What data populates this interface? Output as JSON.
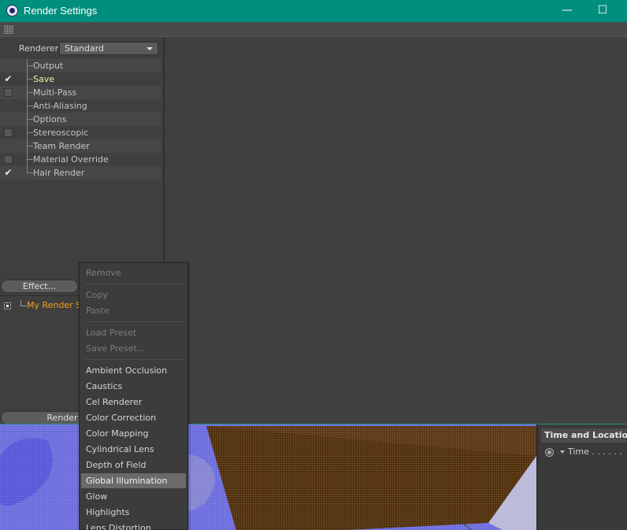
{
  "window": {
    "title": "Render Settings",
    "minimize_glyph": "—",
    "maximize_glyph": "☐"
  },
  "renderer": {
    "label": "Renderer",
    "selected": "Standard"
  },
  "settings_tree": [
    {
      "label": "Output",
      "check": "none",
      "active": false
    },
    {
      "label": "Save",
      "check": "checked",
      "active": true
    },
    {
      "label": "Multi-Pass",
      "check": "unchecked",
      "active": false
    },
    {
      "label": "Anti-Aliasing",
      "check": "none",
      "active": false
    },
    {
      "label": "Options",
      "check": "none",
      "active": false
    },
    {
      "label": "Stereoscopic",
      "check": "unchecked",
      "active": false
    },
    {
      "label": "Team Render",
      "check": "none",
      "active": false
    },
    {
      "label": "Material Override",
      "check": "unchecked",
      "active": false
    },
    {
      "label": "Hair Render",
      "check": "checked",
      "active": false
    }
  ],
  "effect_button": "Effect...",
  "render_setting_item": "My Render S",
  "render_button": "Render",
  "context_menu": {
    "groups": [
      [
        {
          "label": "Remove",
          "disabled": true
        }
      ],
      [
        {
          "label": "Copy",
          "disabled": true
        },
        {
          "label": "Paste",
          "disabled": true
        }
      ],
      [
        {
          "label": "Load Preset",
          "disabled": true
        },
        {
          "label": "Save Preset...",
          "disabled": true
        }
      ],
      [
        {
          "label": "Ambient Occlusion",
          "disabled": false
        },
        {
          "label": "Caustics",
          "disabled": false
        },
        {
          "label": "Cel Renderer",
          "disabled": false
        },
        {
          "label": "Color Correction",
          "disabled": false
        },
        {
          "label": "Color Mapping",
          "disabled": false
        },
        {
          "label": "Cylindrical Lens",
          "disabled": false
        },
        {
          "label": "Depth of Field",
          "disabled": false
        },
        {
          "label": "Global Illumination",
          "disabled": false,
          "highlight": true
        },
        {
          "label": "Glow",
          "disabled": false
        },
        {
          "label": "Highlights",
          "disabled": false
        },
        {
          "label": "Lens Distortion",
          "disabled": false
        }
      ]
    ]
  },
  "attributes": {
    "header": "Time and Location",
    "time_label": "Time . . . . . ."
  },
  "colors": {
    "titlebar": "#008f7d",
    "active_item": "#f0f0a0",
    "render_setting": "#f0a020",
    "viewport_blue": "#6f6fe0",
    "viewport_brown": "#4e2d08"
  }
}
